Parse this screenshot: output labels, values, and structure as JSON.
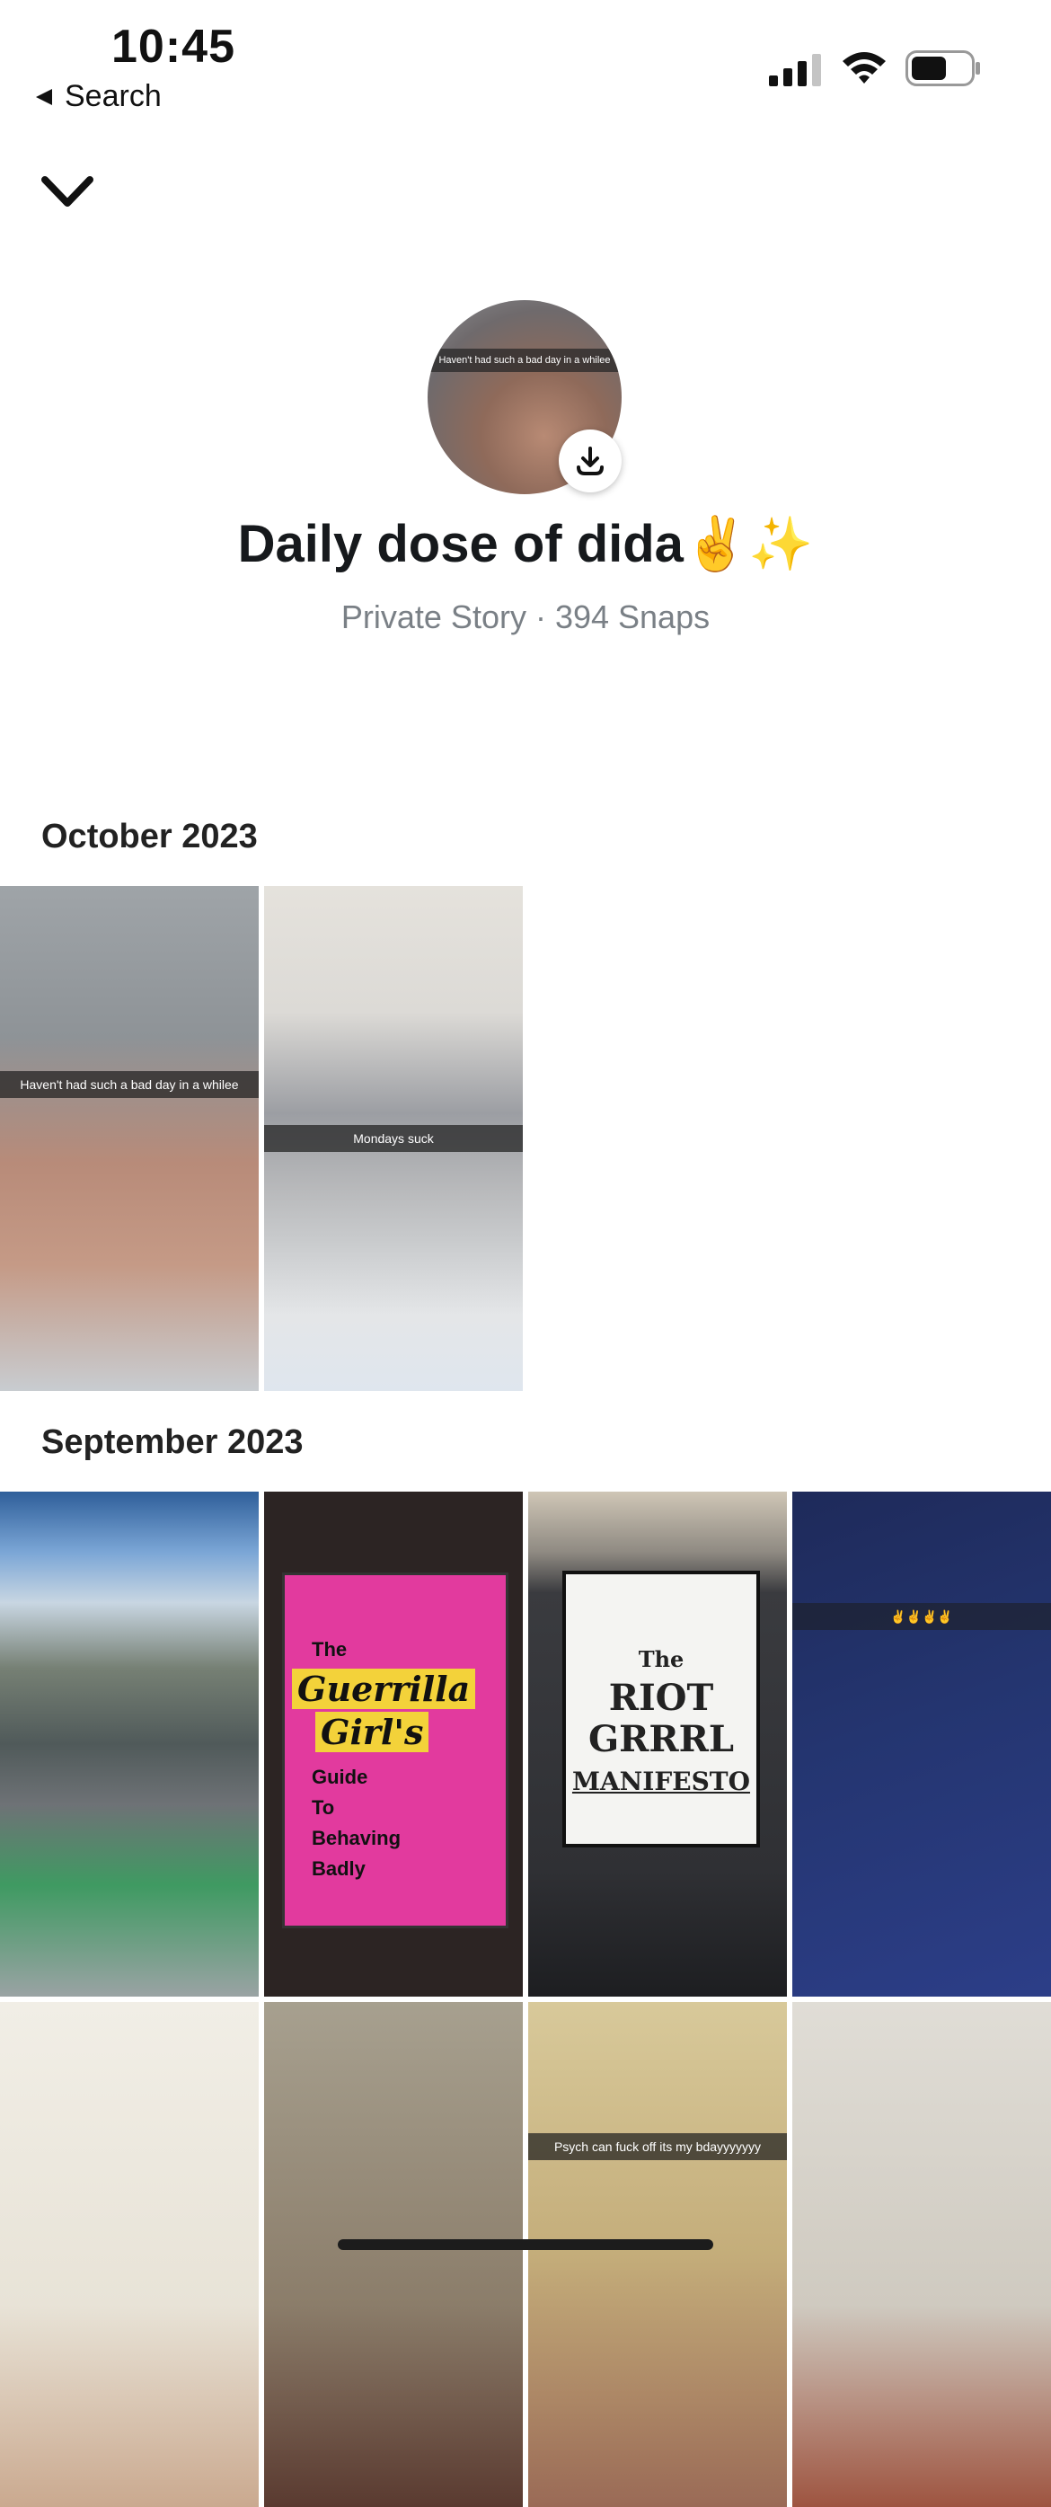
{
  "status_bar": {
    "time": "10:45",
    "back_label": "Search"
  },
  "header": {
    "avatar_caption": "Haven't had such a bad day in a whilee",
    "title": "Daily dose of dida✌️✨",
    "subtitle": "Private Story · 394 Snaps"
  },
  "sections": [
    {
      "title": "October 2023",
      "snaps": [
        {
          "caption": "Haven't had such a bad day in a whilee"
        },
        {
          "caption": "Mondays suck"
        }
      ]
    },
    {
      "title": "September 2023",
      "snaps": [
        {
          "caption": ""
        },
        {
          "caption": "",
          "book": {
            "line1": "The",
            "script1": "Guerrilla",
            "script2": "Girl's",
            "line2": "Guide",
            "line3": "To",
            "line4": "Behaving",
            "line5": "Badly"
          }
        },
        {
          "caption": "",
          "manifesto": {
            "line1": "The",
            "line2": "RIOT",
            "line3": "GRRRL",
            "line4": "MANIFESTO"
          }
        },
        {
          "caption": "✌️✌️✌️✌️"
        },
        {
          "caption": ""
        },
        {
          "caption": ""
        },
        {
          "caption": "Psych can fuck off its my bdayyyyyyy"
        },
        {
          "caption": ""
        }
      ]
    }
  ],
  "colors": {
    "title": "#16191c",
    "subtitle": "#7a8086",
    "background": "#ffffff"
  },
  "icons": [
    "back-triangle-icon",
    "signal-icon",
    "wifi-icon",
    "battery-icon",
    "chevron-down-icon",
    "download-icon"
  ]
}
